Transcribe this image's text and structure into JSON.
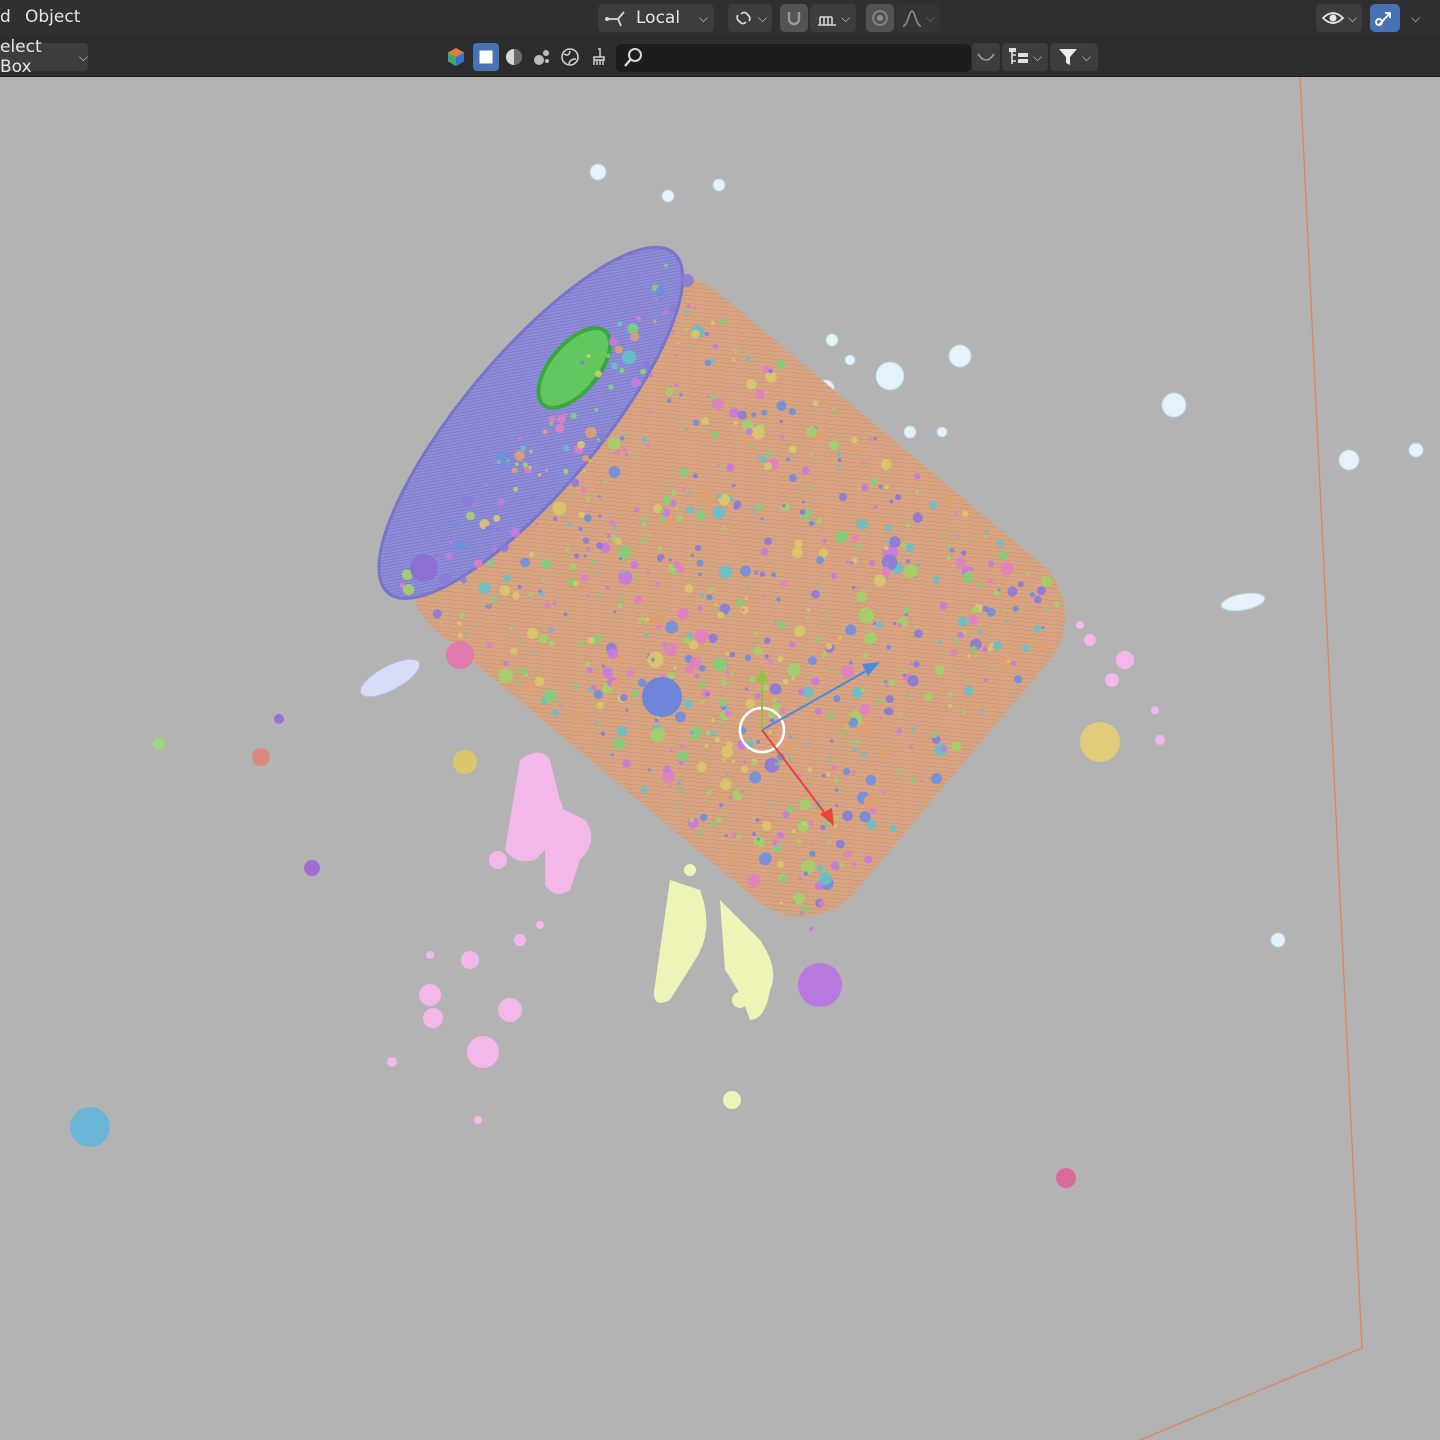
{
  "header": {
    "menus": [
      {
        "label": "d"
      },
      {
        "label": "Object"
      }
    ],
    "transform_orientation": "Local"
  },
  "toolbar": {
    "select_mode": "elect Box"
  },
  "icons": {
    "orientation": "axes-orientation-icon",
    "pivot": "pivot-link-icon",
    "snap": "magnet-icon",
    "snap_target": "snap-increment-icon",
    "proportional": "proportional-edit-icon",
    "falloff": "falloff-curve-icon",
    "visibility": "eye-icon",
    "gizmo": "gizmo-icon",
    "search": "search-icon",
    "filter": "funnel-icon"
  },
  "colors": {
    "header_bg": "#303030",
    "toolbar_bg": "#2d2d2d",
    "viewport_bg": "#b3b3b3",
    "active_accent": "#4772b3",
    "can_body": "#d9a380",
    "can_top": "#8d8cd6",
    "gizmo_x": "#e8443d",
    "gizmo_y": "#8cc63f",
    "gizmo_z": "#4d88e0",
    "domain_line": "#d98860"
  }
}
